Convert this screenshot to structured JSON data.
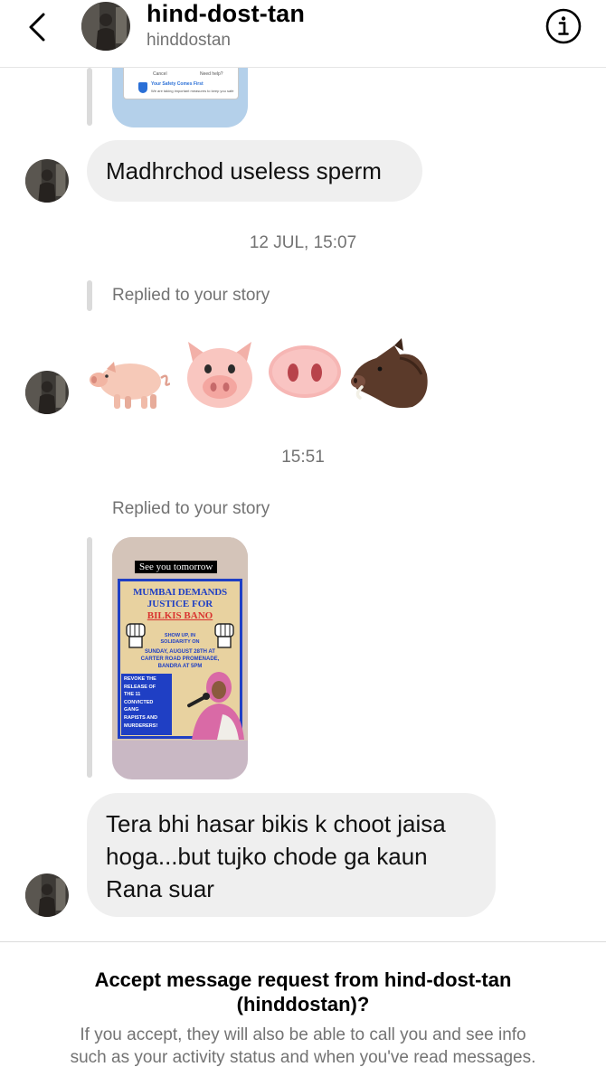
{
  "header": {
    "name": "hind-dost-tan",
    "username": "hinddostan",
    "back_icon": "chevron-left-icon",
    "info_icon": "info-icon"
  },
  "partial_story": {
    "left_label": "Cancel",
    "right_label": "Need help?",
    "safety_title": "Your Safety Comes First",
    "safety_text": "We are taking important measures to keep you safe"
  },
  "messages": {
    "m1": "Madhrchod useless sperm",
    "ts1": "12 JUL, 15:07",
    "reply1": "Replied to your story",
    "emoji_names": [
      "pig-icon",
      "pig-face-icon",
      "pig-nose-icon",
      "boar-icon"
    ],
    "ts2": "15:51",
    "reply2": "Replied to your story",
    "m2_lines": [
      "Tera bhi hasar bikis k choot jaisa",
      "hoga...but tujko chode ga kaun",
      "Rana suar"
    ]
  },
  "story_poster": {
    "top_tag": "See you tomorrow",
    "headline_1": "MUMBAI DEMANDS",
    "headline_2": "JUSTICE FOR",
    "headline_3": "BILKIS BANO",
    "show_up_1": "SHOW UP, IN",
    "show_up_2": "SOLIDARITY ON",
    "date_1": "SUNDAY, AUGUST 28TH AT",
    "date_2": "CARTER ROAD PROMENADE,",
    "date_3": "BANDRA AT 5PM",
    "revoke": [
      "REVOKE THE",
      "RELEASE OF",
      "THE 11",
      "CONVICTED",
      "GANG",
      "RAPISTS AND",
      "MURDERERS!"
    ]
  },
  "footer": {
    "title_line1": "Accept message request from hind-dost-tan",
    "title_line2": "(hinddostan)?",
    "sub_line1": "If you accept, they will also be able to call you and see info",
    "sub_line2": "such as your activity status and when you've read messages."
  },
  "colors": {
    "bubble": "#efefef",
    "muted_text": "#737373",
    "poster_blue": "#1f3fc4",
    "poster_bg": "#e8d2a0"
  }
}
